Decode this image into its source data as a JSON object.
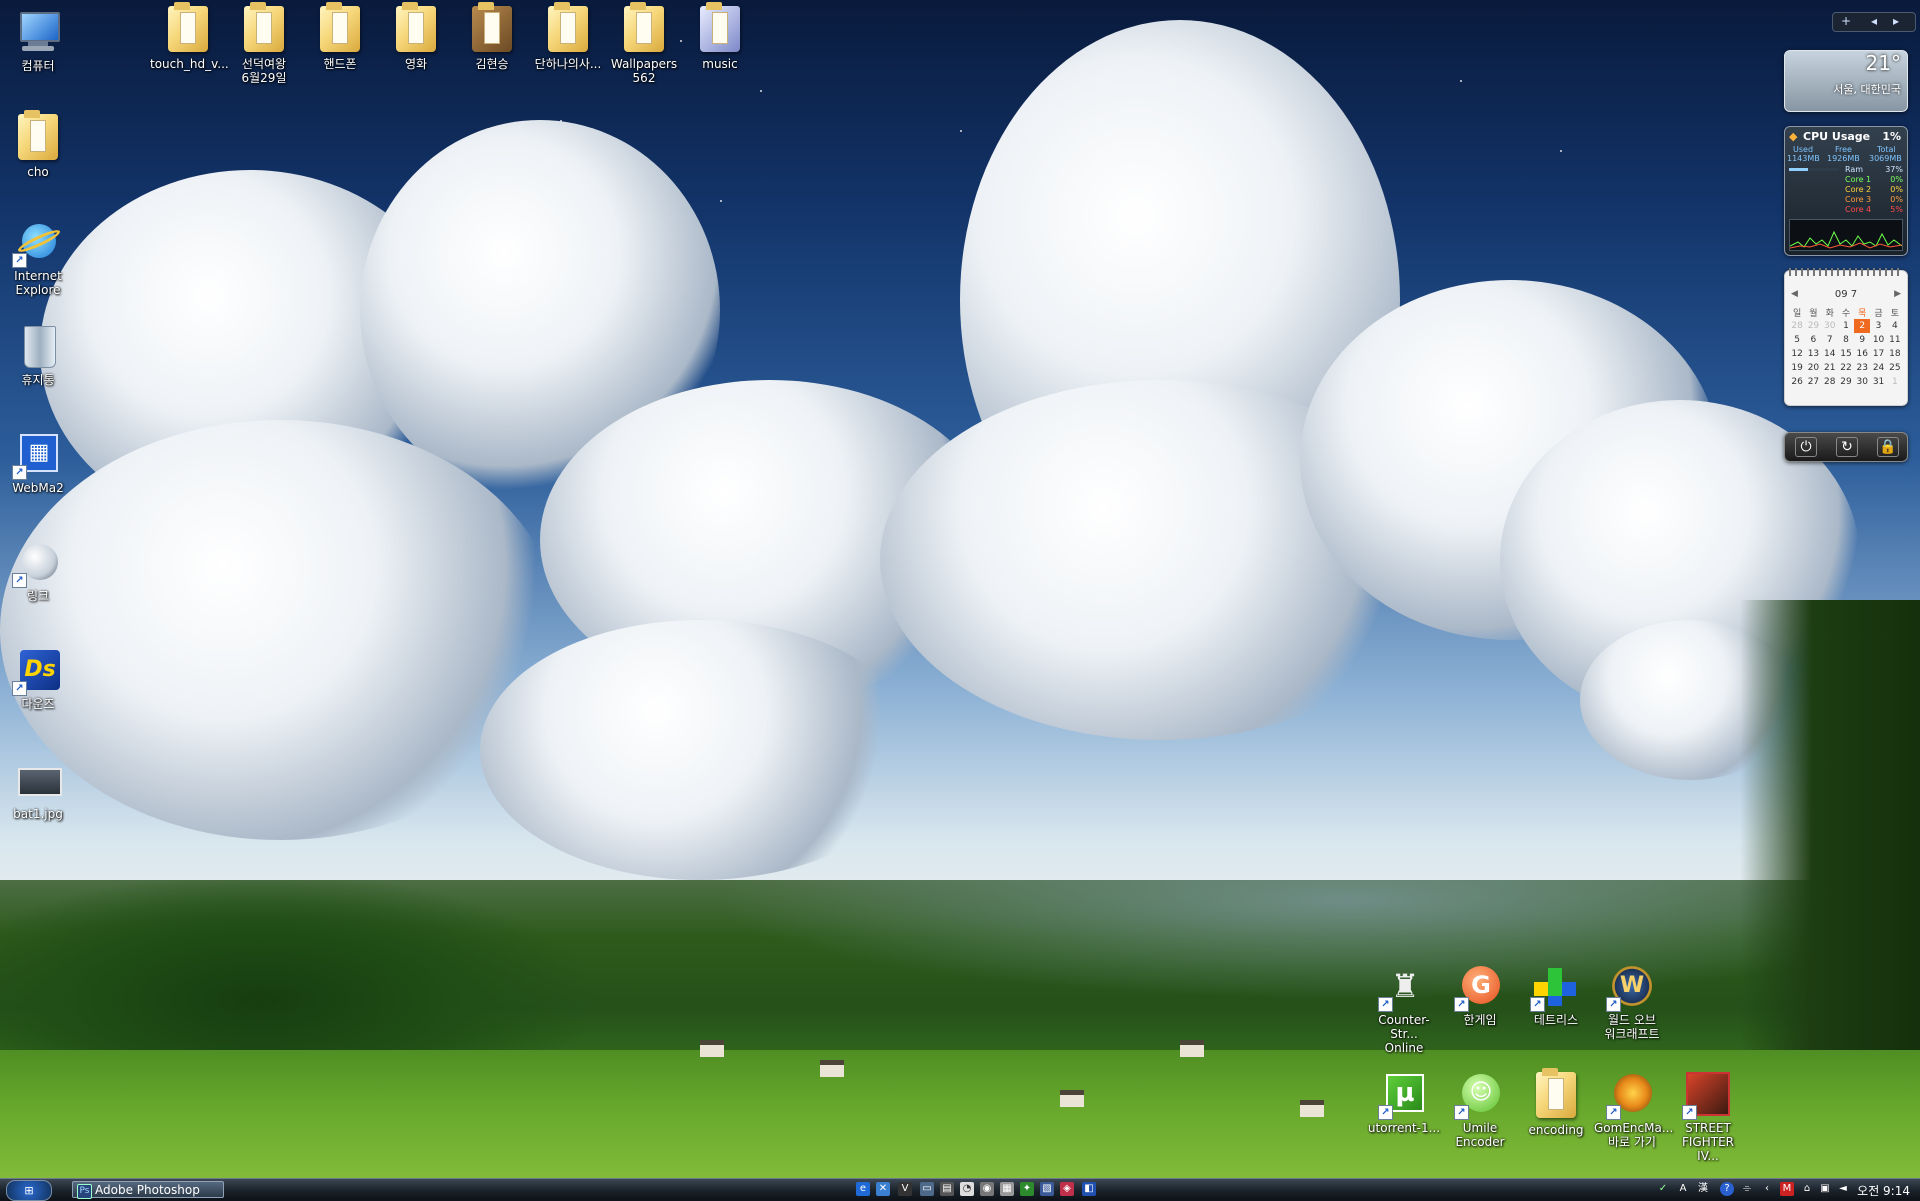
{
  "desktop": {
    "top_icons": [
      {
        "name": "computer",
        "label": "컴퓨터"
      },
      {
        "name": "folder-touch",
        "label": "touch_hd_v..."
      },
      {
        "name": "folder-trip",
        "label": "선덕여왕\n6월29일"
      },
      {
        "name": "folder-phone",
        "label": "핸드폰"
      },
      {
        "name": "folder-movie",
        "label": "영화"
      },
      {
        "name": "folder-kim",
        "label": "김현승"
      },
      {
        "name": "folder-book",
        "label": "단하나의사..."
      },
      {
        "name": "folder-wallpapers",
        "label": "Wallpapers\n562"
      },
      {
        "name": "folder-music",
        "label": "music"
      }
    ],
    "left_icons": [
      {
        "name": "cho",
        "label": "cho"
      },
      {
        "name": "ie",
        "label": "Internet\nExplore"
      },
      {
        "name": "recycle",
        "label": "휴지통"
      },
      {
        "name": "webma",
        "label": "WebMa2"
      },
      {
        "name": "link",
        "label": "링크"
      },
      {
        "name": "daum",
        "label": "다운즈"
      },
      {
        "name": "bat",
        "label": "bat1.jpg"
      }
    ],
    "bottom_icons": [
      {
        "name": "cs",
        "label": "Counter-Str...\nOnline"
      },
      {
        "name": "hangame",
        "label": "한게임"
      },
      {
        "name": "tetris",
        "label": "테트리스"
      },
      {
        "name": "wow",
        "label": "월드 오브\n워크래프트"
      },
      {
        "name": "utorrent",
        "label": "utorrent-1..."
      },
      {
        "name": "umile",
        "label": "Umile\nEncoder"
      },
      {
        "name": "encoding",
        "label": "encoding"
      },
      {
        "name": "gomenc",
        "label": "GomEncMa...\n바로 가기"
      },
      {
        "name": "sf4",
        "label": "STREET\nFIGHTER IV..."
      }
    ]
  },
  "gadgets": {
    "weather": {
      "temp": "21°",
      "location": "서울, 대한민국"
    },
    "cpu": {
      "title": "CPU Usage",
      "percent": "1%",
      "used_label": "Used",
      "free_label": "Free",
      "total_label": "Total",
      "used": "1143MB",
      "free": "1926MB",
      "total": "3069MB",
      "ram_label": "Ram",
      "ram": "37%",
      "cores": [
        {
          "label": "Core 1",
          "value": "0%",
          "color": "#7cff5a"
        },
        {
          "label": "Core 2",
          "value": "0%",
          "color": "#ffd23a"
        },
        {
          "label": "Core 3",
          "value": "0%",
          "color": "#ff9a3a"
        },
        {
          "label": "Core 4",
          "value": "5%",
          "color": "#ff4a4a"
        }
      ]
    },
    "calendar": {
      "header": "09 7",
      "weekdays": [
        "일",
        "월",
        "화",
        "수",
        "목",
        "금",
        "토"
      ],
      "weeks": [
        [
          "28",
          "29",
          "30",
          "1",
          "2",
          "3",
          "4"
        ],
        [
          "5",
          "6",
          "7",
          "8",
          "9",
          "10",
          "11"
        ],
        [
          "12",
          "13",
          "14",
          "15",
          "16",
          "17",
          "18"
        ],
        [
          "19",
          "20",
          "21",
          "22",
          "23",
          "24",
          "25"
        ],
        [
          "26",
          "27",
          "28",
          "29",
          "30",
          "31",
          "1"
        ]
      ],
      "today": "2"
    }
  },
  "taskbar": {
    "start": "⊞",
    "tasks": [
      {
        "label": "Adobe Photoshop"
      }
    ],
    "clock": "오전 9:14",
    "colors": {
      "accent": "#2a6ad0"
    }
  }
}
